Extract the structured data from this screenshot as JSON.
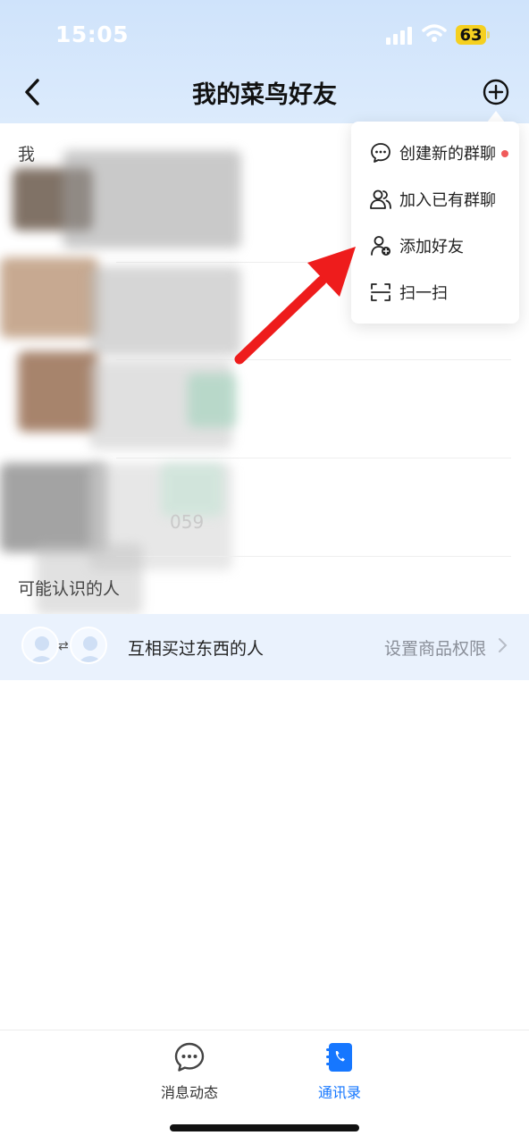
{
  "status_bar": {
    "time": "15:05",
    "battery": "63"
  },
  "nav": {
    "title": "我的菜鸟好友"
  },
  "list": {
    "section_mine_partial": "我",
    "partial_number": "059",
    "section_maybe_known": "可能认识的人"
  },
  "recommend_row": {
    "label": "互相买过东西的人",
    "action": "设置商品权限"
  },
  "popup_menu": {
    "items": [
      {
        "label": "创建新的群聊",
        "icon": "chat-bubble-icon",
        "badge": true
      },
      {
        "label": "加入已有群聊",
        "icon": "group-users-icon",
        "badge": false
      },
      {
        "label": "添加好友",
        "icon": "add-user-icon",
        "badge": false
      },
      {
        "label": "扫一扫",
        "icon": "scan-icon",
        "badge": false
      }
    ]
  },
  "tabbar": {
    "tabs": [
      {
        "label": "消息动态",
        "active": false
      },
      {
        "label": "通讯录",
        "active": true
      }
    ]
  },
  "colors": {
    "accent": "#1677ff",
    "header_bg": "#d6e8fb",
    "badge_red": "#f05a5a",
    "arrow_red": "#ee1c1c"
  }
}
